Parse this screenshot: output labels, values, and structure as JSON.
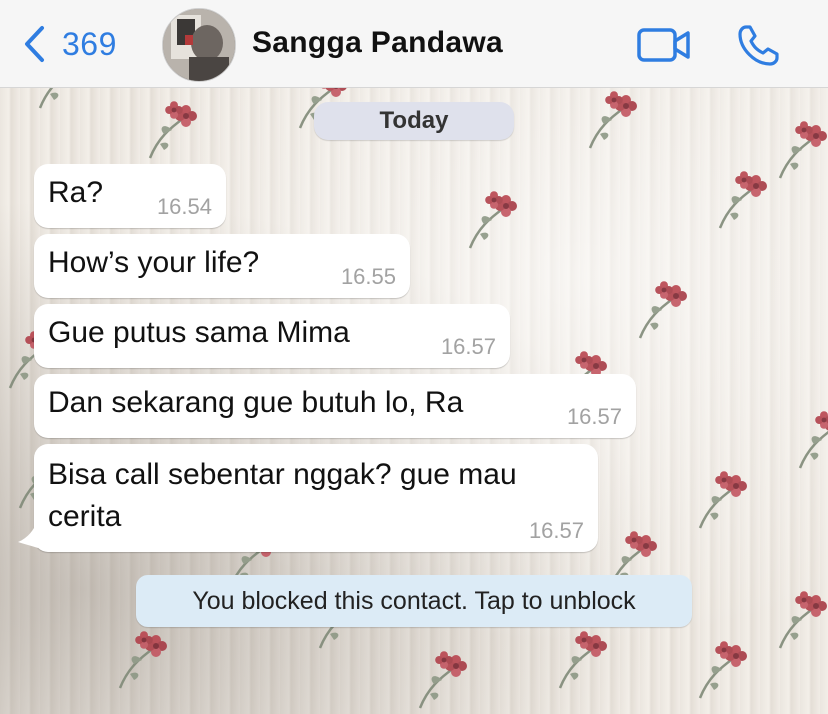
{
  "header": {
    "back_count": "369",
    "contact_name": "Sangga Pandawa",
    "accent_color": "#2f7de1"
  },
  "icons": {
    "back": "chevron-left-icon",
    "video": "video-camera-icon",
    "call": "phone-icon"
  },
  "chat": {
    "date_label": "Today",
    "messages": [
      {
        "text": "Ra?",
        "time": "16.54"
      },
      {
        "text": "How’s your life?",
        "time": "16.55"
      },
      {
        "text": "Gue putus sama Mima",
        "time": "16.57"
      },
      {
        "text": "Dan sekarang gue butuh lo, Ra",
        "time": "16.57"
      },
      {
        "text": "Bisa call sebentar nggak? gue mau cerita",
        "time": "16.57"
      }
    ],
    "blocked_notice": "You blocked this contact. Tap to unblock"
  }
}
